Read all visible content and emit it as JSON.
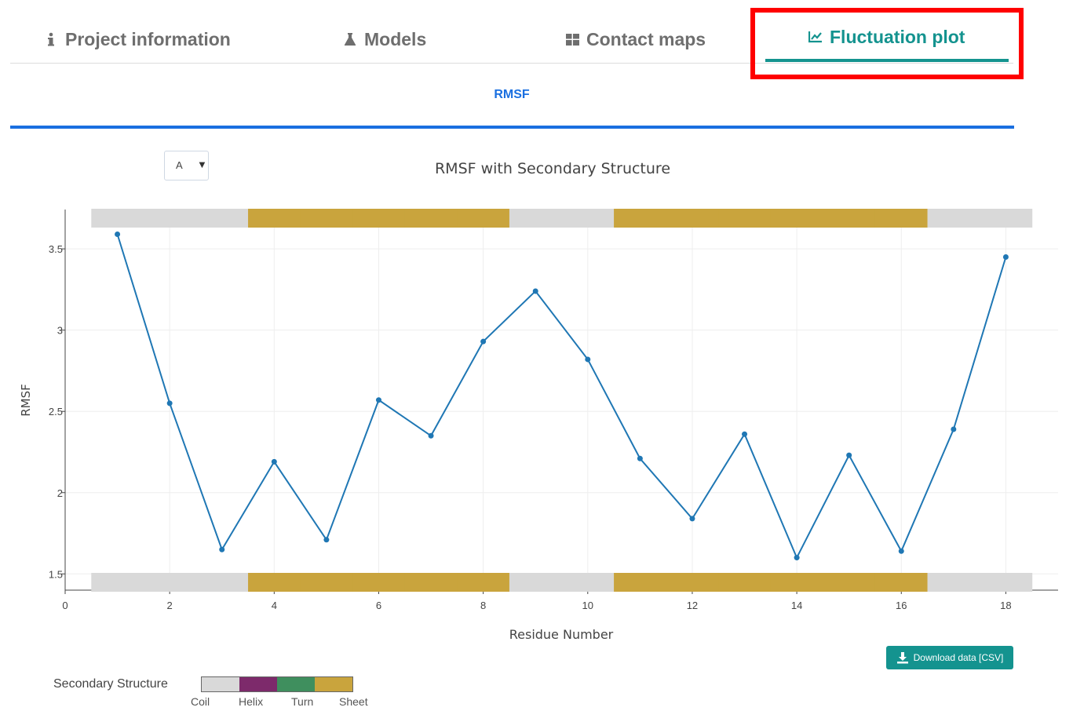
{
  "tabs": [
    {
      "label": "Project information",
      "icon": "info-icon",
      "active": false
    },
    {
      "label": "Models",
      "icon": "flask-icon",
      "active": false
    },
    {
      "label": "Contact maps",
      "icon": "grid-icon",
      "active": false
    },
    {
      "label": "Fluctuation plot",
      "icon": "line-chart-icon",
      "active": true
    }
  ],
  "subtab": {
    "label": "RMSF"
  },
  "chain_select": {
    "value": "A"
  },
  "download": {
    "label": "Download data [CSV]",
    "icon": "download-icon"
  },
  "legend": {
    "title": "Secondary Structure",
    "items": [
      {
        "label": "Coil",
        "color": "#d9d9d9"
      },
      {
        "label": "Helix",
        "color": "#7d2a6b"
      },
      {
        "label": "Turn",
        "color": "#3f8f5e"
      },
      {
        "label": "Sheet",
        "color": "#c9a43d"
      }
    ]
  },
  "colors": {
    "accent": "#14938f",
    "blue": "#1a6fe0",
    "line": "#1f77b4",
    "highlight": "#ff0000"
  },
  "chart_data": {
    "type": "line",
    "title": "RMSF with Secondary Structure",
    "xlabel": "Residue Number",
    "ylabel": "RMSF",
    "xlim": [
      0,
      19
    ],
    "ylim": [
      1.4,
      3.8
    ],
    "xticks": [
      0,
      2,
      4,
      6,
      8,
      10,
      12,
      14,
      16,
      18
    ],
    "yticks": [
      1.5,
      2,
      2.5,
      3,
      3.5
    ],
    "ytick_labels": [
      "1.5",
      "2",
      "2.5",
      "3",
      "3.5"
    ],
    "grid": true,
    "x": [
      1,
      2,
      3,
      4,
      5,
      6,
      7,
      8,
      9,
      10,
      11,
      12,
      13,
      14,
      15,
      16,
      17,
      18
    ],
    "y": [
      3.59,
      2.55,
      1.65,
      2.19,
      1.71,
      2.57,
      2.35,
      2.93,
      3.24,
      2.82,
      2.21,
      1.84,
      2.36,
      1.6,
      2.23,
      1.64,
      2.39,
      3.45
    ],
    "secondary_structure": [
      "Coil",
      "Coil",
      "Coil",
      "Sheet",
      "Sheet",
      "Sheet",
      "Sheet",
      "Sheet",
      "Coil",
      "Coil",
      "Sheet",
      "Sheet",
      "Sheet",
      "Sheet",
      "Sheet",
      "Sheet",
      "Coil",
      "Coil"
    ]
  }
}
